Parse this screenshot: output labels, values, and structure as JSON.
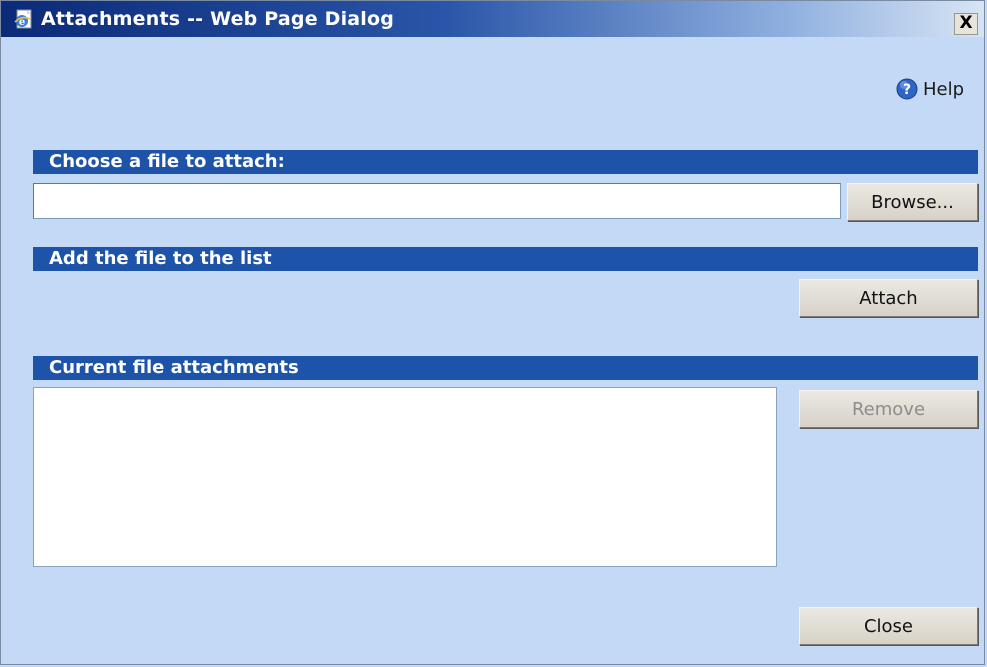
{
  "window": {
    "title": "Attachments -- Web Page Dialog",
    "close_glyph": "X"
  },
  "help": {
    "label": "Help"
  },
  "sections": {
    "choose": "Choose a file to attach:",
    "add": "Add the file to the list",
    "current": "Current file attachments"
  },
  "file_input": {
    "value": "",
    "placeholder": ""
  },
  "buttons": {
    "browse": "Browse...",
    "attach": "Attach",
    "remove": "Remove",
    "close": "Close"
  },
  "icons": {
    "title": "ie-page-icon",
    "help": "help-question-icon"
  },
  "colors": {
    "background": "#c3d9f5",
    "section_bar": "#1d53a8",
    "title_bar": "#0b2a78"
  }
}
